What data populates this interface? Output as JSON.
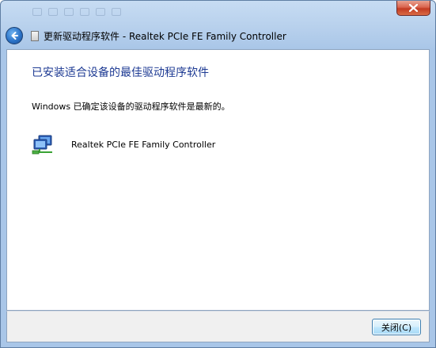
{
  "window": {
    "title": "更新驱动程序软件 - Realtek PCIe FE Family Controller",
    "close_icon": "close-icon",
    "back_icon": "back-arrow-icon"
  },
  "content": {
    "heading": "已安装适合设备的最佳驱动程序软件",
    "message": "Windows 已确定该设备的驱动程序软件是最新的。",
    "device": {
      "icon": "network-adapter-icon",
      "name": "Realtek PCIe FE Family Controller"
    }
  },
  "footer": {
    "close_label": "关闭(C)"
  },
  "colors": {
    "heading": "#1d3a93",
    "frame": "#a9c6e8",
    "close_red": "#c23b22"
  }
}
